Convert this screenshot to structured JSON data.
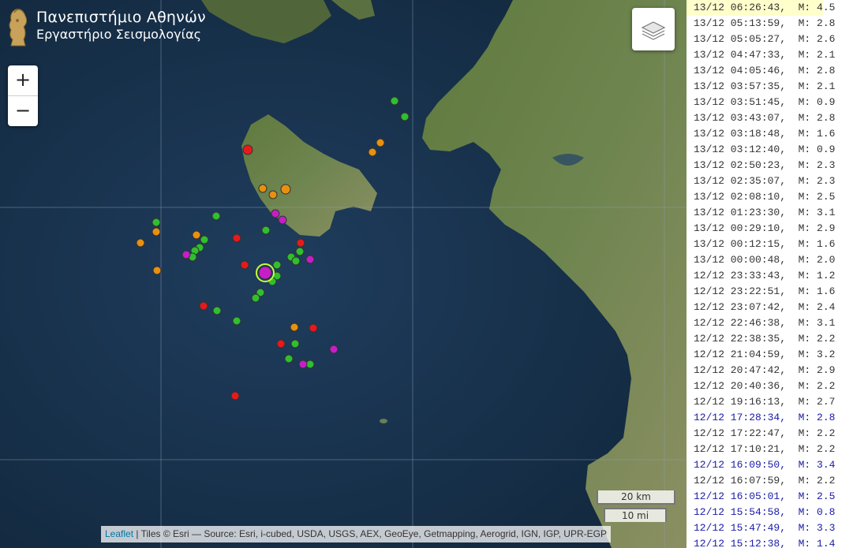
{
  "logo": {
    "line1": "Πανεπιστήμιο Αθηνών",
    "line2": "Εργαστήριο Σεισμολογίας"
  },
  "zoom": {
    "in": "+",
    "out": "−"
  },
  "scale": {
    "km": "20 km",
    "mi": "10 mi"
  },
  "attribution": {
    "leaflet": "Leaflet",
    "rest": " | Tiles © Esri — Source: Esri, i-cubed, USDA, USGS, AEX, GeoEye, Getmapping, Aerogrid, IGN, IGP, UPR-EGP"
  },
  "colors": {
    "red": "#e8191c",
    "orange": "#e8900f",
    "green": "#2fbf2f",
    "magenta": "#c51ec9",
    "highlight": "#ffffcc",
    "blue_text": "#1a1aa8"
  },
  "events": [
    {
      "text": "13/12 06:26:43,  M: 4.5",
      "highlight": true,
      "blue": false
    },
    {
      "text": "13/12 05:13:59,  M: 2.8",
      "highlight": false,
      "blue": false
    },
    {
      "text": "13/12 05:05:27,  M: 2.6",
      "highlight": false,
      "blue": false
    },
    {
      "text": "13/12 04:47:33,  M: 2.1",
      "highlight": false,
      "blue": false
    },
    {
      "text": "13/12 04:05:46,  M: 2.8",
      "highlight": false,
      "blue": false
    },
    {
      "text": "13/12 03:57:35,  M: 2.1",
      "highlight": false,
      "blue": false
    },
    {
      "text": "13/12 03:51:45,  M: 0.9",
      "highlight": false,
      "blue": false
    },
    {
      "text": "13/12 03:43:07,  M: 2.8",
      "highlight": false,
      "blue": false
    },
    {
      "text": "13/12 03:18:48,  M: 1.6",
      "highlight": false,
      "blue": false
    },
    {
      "text": "13/12 03:12:40,  M: 0.9",
      "highlight": false,
      "blue": false
    },
    {
      "text": "13/12 02:50:23,  M: 2.3",
      "highlight": false,
      "blue": false
    },
    {
      "text": "13/12 02:35:07,  M: 2.3",
      "highlight": false,
      "blue": false
    },
    {
      "text": "13/12 02:08:10,  M: 2.5",
      "highlight": false,
      "blue": false
    },
    {
      "text": "13/12 01:23:30,  M: 3.1",
      "highlight": false,
      "blue": false
    },
    {
      "text": "13/12 00:29:10,  M: 2.9",
      "highlight": false,
      "blue": false
    },
    {
      "text": "13/12 00:12:15,  M: 1.6",
      "highlight": false,
      "blue": false
    },
    {
      "text": "13/12 00:00:48,  M: 2.0",
      "highlight": false,
      "blue": false
    },
    {
      "text": "12/12 23:33:43,  M: 1.2",
      "highlight": false,
      "blue": false
    },
    {
      "text": "12/12 23:22:51,  M: 1.6",
      "highlight": false,
      "blue": false
    },
    {
      "text": "12/12 23:07:42,  M: 2.4",
      "highlight": false,
      "blue": false
    },
    {
      "text": "12/12 22:46:38,  M: 3.1",
      "highlight": false,
      "blue": false
    },
    {
      "text": "12/12 22:38:35,  M: 2.2",
      "highlight": false,
      "blue": false
    },
    {
      "text": "12/12 21:04:59,  M: 3.2",
      "highlight": false,
      "blue": false
    },
    {
      "text": "12/12 20:47:42,  M: 2.9",
      "highlight": false,
      "blue": false
    },
    {
      "text": "12/12 20:40:36,  M: 2.2",
      "highlight": false,
      "blue": false
    },
    {
      "text": "12/12 19:16:13,  M: 2.7",
      "highlight": false,
      "blue": false
    },
    {
      "text": "12/12 17:28:34,  M: 2.8",
      "highlight": false,
      "blue": true
    },
    {
      "text": "12/12 17:22:47,  M: 2.2",
      "highlight": false,
      "blue": false
    },
    {
      "text": "12/12 17:10:21,  M: 2.2",
      "highlight": false,
      "blue": false
    },
    {
      "text": "12/12 16:09:50,  M: 3.4",
      "highlight": false,
      "blue": true
    },
    {
      "text": "12/12 16:07:59,  M: 2.2",
      "highlight": false,
      "blue": false
    },
    {
      "text": "12/12 16:05:01,  M: 2.5",
      "highlight": false,
      "blue": true
    },
    {
      "text": "12/12 15:54:58,  M: 0.8",
      "highlight": false,
      "blue": true
    },
    {
      "text": "12/12 15:47:49,  M: 3.3",
      "highlight": false,
      "blue": true
    },
    {
      "text": "12/12 15:12:38,  M: 1.4",
      "highlight": false,
      "blue": true
    }
  ],
  "markers": {
    "red_count": 9,
    "orange_count": 11,
    "green_count": 25,
    "magenta_count": 6,
    "selected": "magenta"
  }
}
